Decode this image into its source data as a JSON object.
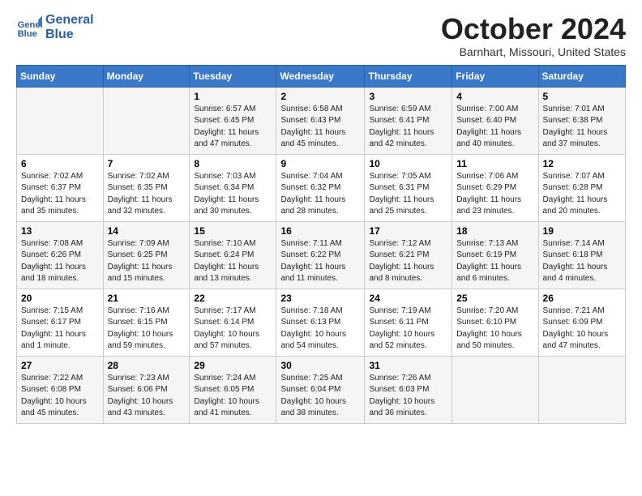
{
  "header": {
    "logo_line1": "General",
    "logo_line2": "Blue",
    "month": "October 2024",
    "location": "Barnhart, Missouri, United States"
  },
  "days_of_week": [
    "Sunday",
    "Monday",
    "Tuesday",
    "Wednesday",
    "Thursday",
    "Friday",
    "Saturday"
  ],
  "weeks": [
    [
      {
        "day": "",
        "info": ""
      },
      {
        "day": "",
        "info": ""
      },
      {
        "day": "1",
        "info": "Sunrise: 6:57 AM\nSunset: 6:45 PM\nDaylight: 11 hours and 47 minutes."
      },
      {
        "day": "2",
        "info": "Sunrise: 6:58 AM\nSunset: 6:43 PM\nDaylight: 11 hours and 45 minutes."
      },
      {
        "day": "3",
        "info": "Sunrise: 6:59 AM\nSunset: 6:41 PM\nDaylight: 11 hours and 42 minutes."
      },
      {
        "day": "4",
        "info": "Sunrise: 7:00 AM\nSunset: 6:40 PM\nDaylight: 11 hours and 40 minutes."
      },
      {
        "day": "5",
        "info": "Sunrise: 7:01 AM\nSunset: 6:38 PM\nDaylight: 11 hours and 37 minutes."
      }
    ],
    [
      {
        "day": "6",
        "info": "Sunrise: 7:02 AM\nSunset: 6:37 PM\nDaylight: 11 hours and 35 minutes."
      },
      {
        "day": "7",
        "info": "Sunrise: 7:02 AM\nSunset: 6:35 PM\nDaylight: 11 hours and 32 minutes."
      },
      {
        "day": "8",
        "info": "Sunrise: 7:03 AM\nSunset: 6:34 PM\nDaylight: 11 hours and 30 minutes."
      },
      {
        "day": "9",
        "info": "Sunrise: 7:04 AM\nSunset: 6:32 PM\nDaylight: 11 hours and 28 minutes."
      },
      {
        "day": "10",
        "info": "Sunrise: 7:05 AM\nSunset: 6:31 PM\nDaylight: 11 hours and 25 minutes."
      },
      {
        "day": "11",
        "info": "Sunrise: 7:06 AM\nSunset: 6:29 PM\nDaylight: 11 hours and 23 minutes."
      },
      {
        "day": "12",
        "info": "Sunrise: 7:07 AM\nSunset: 6:28 PM\nDaylight: 11 hours and 20 minutes."
      }
    ],
    [
      {
        "day": "13",
        "info": "Sunrise: 7:08 AM\nSunset: 6:26 PM\nDaylight: 11 hours and 18 minutes."
      },
      {
        "day": "14",
        "info": "Sunrise: 7:09 AM\nSunset: 6:25 PM\nDaylight: 11 hours and 15 minutes."
      },
      {
        "day": "15",
        "info": "Sunrise: 7:10 AM\nSunset: 6:24 PM\nDaylight: 11 hours and 13 minutes."
      },
      {
        "day": "16",
        "info": "Sunrise: 7:11 AM\nSunset: 6:22 PM\nDaylight: 11 hours and 11 minutes."
      },
      {
        "day": "17",
        "info": "Sunrise: 7:12 AM\nSunset: 6:21 PM\nDaylight: 11 hours and 8 minutes."
      },
      {
        "day": "18",
        "info": "Sunrise: 7:13 AM\nSunset: 6:19 PM\nDaylight: 11 hours and 6 minutes."
      },
      {
        "day": "19",
        "info": "Sunrise: 7:14 AM\nSunset: 6:18 PM\nDaylight: 11 hours and 4 minutes."
      }
    ],
    [
      {
        "day": "20",
        "info": "Sunrise: 7:15 AM\nSunset: 6:17 PM\nDaylight: 11 hours and 1 minute."
      },
      {
        "day": "21",
        "info": "Sunrise: 7:16 AM\nSunset: 6:15 PM\nDaylight: 10 hours and 59 minutes."
      },
      {
        "day": "22",
        "info": "Sunrise: 7:17 AM\nSunset: 6:14 PM\nDaylight: 10 hours and 57 minutes."
      },
      {
        "day": "23",
        "info": "Sunrise: 7:18 AM\nSunset: 6:13 PM\nDaylight: 10 hours and 54 minutes."
      },
      {
        "day": "24",
        "info": "Sunrise: 7:19 AM\nSunset: 6:11 PM\nDaylight: 10 hours and 52 minutes."
      },
      {
        "day": "25",
        "info": "Sunrise: 7:20 AM\nSunset: 6:10 PM\nDaylight: 10 hours and 50 minutes."
      },
      {
        "day": "26",
        "info": "Sunrise: 7:21 AM\nSunset: 6:09 PM\nDaylight: 10 hours and 47 minutes."
      }
    ],
    [
      {
        "day": "27",
        "info": "Sunrise: 7:22 AM\nSunset: 6:08 PM\nDaylight: 10 hours and 45 minutes."
      },
      {
        "day": "28",
        "info": "Sunrise: 7:23 AM\nSunset: 6:06 PM\nDaylight: 10 hours and 43 minutes."
      },
      {
        "day": "29",
        "info": "Sunrise: 7:24 AM\nSunset: 6:05 PM\nDaylight: 10 hours and 41 minutes."
      },
      {
        "day": "30",
        "info": "Sunrise: 7:25 AM\nSunset: 6:04 PM\nDaylight: 10 hours and 38 minutes."
      },
      {
        "day": "31",
        "info": "Sunrise: 7:26 AM\nSunset: 6:03 PM\nDaylight: 10 hours and 36 minutes."
      },
      {
        "day": "",
        "info": ""
      },
      {
        "day": "",
        "info": ""
      }
    ]
  ]
}
